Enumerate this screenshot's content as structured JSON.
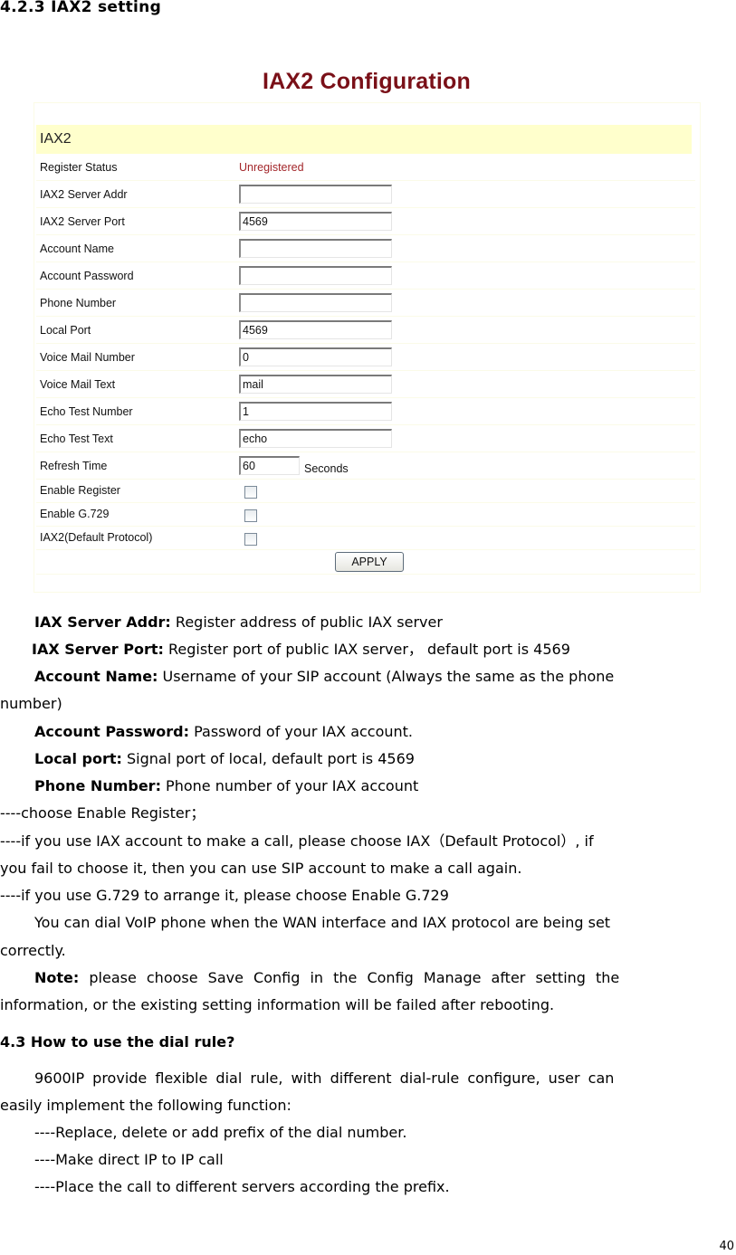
{
  "section_heading": "4.2.3 IAX2 setting",
  "screenshot": {
    "title": "IAX2 Configuration",
    "section_label": "IAX2",
    "register_status": {
      "label": "Register Status",
      "value": "Unregistered",
      "color": "#a3262a"
    },
    "fields": [
      {
        "label": "IAX2 Server Addr",
        "value": ""
      },
      {
        "label": "IAX2 Server Port",
        "value": "4569"
      },
      {
        "label": "Account Name",
        "value": ""
      },
      {
        "label": "Account Password",
        "value": ""
      },
      {
        "label": "Phone Number",
        "value": ""
      },
      {
        "label": "Local Port",
        "value": "4569"
      },
      {
        "label": "Voice Mail Number",
        "value": "0"
      },
      {
        "label": "Voice Mail Text",
        "value": "mail"
      },
      {
        "label": "Echo Test Number",
        "value": "1"
      },
      {
        "label": "Echo Test Text",
        "value": "echo"
      }
    ],
    "refresh": {
      "label": "Refresh Time",
      "value": "60",
      "unit": "Seconds"
    },
    "checkboxes": [
      {
        "label": "Enable Register",
        "checked": false
      },
      {
        "label": "Enable G.729",
        "checked": false
      },
      {
        "label": "IAX2(Default Protocol)",
        "checked": false
      }
    ],
    "apply_label": "APPLY",
    "title_color": "#7a1018",
    "header_bg": "#ffffcc"
  },
  "descriptions": [
    {
      "term": "IAX Server Addr:",
      "text": " Register address of public IAX server"
    },
    {
      "term": "IAX Server Port:",
      "text": " Register port of public IAX server， default port is 4569"
    },
    {
      "term": "Account Name:",
      "text": " Username of your SIP account (Always the same as the phone"
    },
    {
      "term": "",
      "text": "number)"
    },
    {
      "term": "Account Password:",
      "text": " Password of your IAX account."
    },
    {
      "term": "Local port:",
      "text": " Signal port of local, default port is 4569"
    },
    {
      "term": "Phone Number:",
      "text": " Phone number of your IAX account"
    }
  ],
  "notes": [
    "----choose Enable Register；",
    "----if you use IAX account to make a call, please choose IAX（Default Protocol）, if",
    "you fail to choose it, then you can use SIP account to make a call again.",
    "----if you use G.729 to arrange it, please choose Enable G.729"
  ],
  "voip_line1": "You can dial VoIP phone when the WAN interface and IAX protocol are being set",
  "voip_line2": "correctly.",
  "note": {
    "term": "Note:",
    "line1": " please choose Save Config in the Config Manage after setting the",
    "line2": "information, or the existing setting information will be failed after rebooting."
  },
  "section2": {
    "heading": "4.3 How to use the dial rule?",
    "intro_line1": "9600IP provide flexible dial rule, with different dial-rule configure, user can",
    "intro_line2": "easily implement the following function:",
    "bullets": [
      "----Replace, delete or add prefix of the dial number.",
      "----Make direct IP to IP call",
      "----Place the call to different servers according the prefix."
    ]
  },
  "page_number": "40"
}
